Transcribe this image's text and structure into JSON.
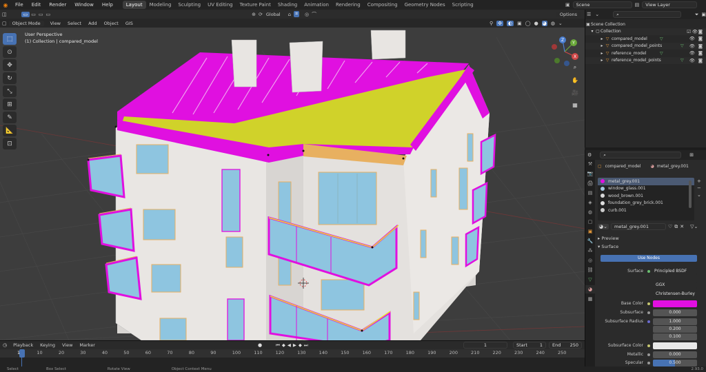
{
  "menu": {
    "items": [
      "File",
      "Edit",
      "Render",
      "Window",
      "Help"
    ]
  },
  "workspace_tabs": [
    "Layout",
    "Modeling",
    "Sculpting",
    "UV Editing",
    "Texture Paint",
    "Shading",
    "Animation",
    "Rendering",
    "Compositing",
    "Geometry Nodes",
    "Scripting"
  ],
  "active_tab": "Layout",
  "scene": {
    "name": "Scene",
    "view_layer": "View Layer"
  },
  "viewport": {
    "mode": "Object Mode",
    "header_menus": [
      "View",
      "Select",
      "Add",
      "Object",
      "GIS"
    ],
    "orientation": "Global",
    "options_label": "Options",
    "overlay_line1": "User Perspective",
    "overlay_line2": "(1) Collection | compared_model",
    "gizmo_axes": {
      "x": "X",
      "y": "Y",
      "z": "Z"
    }
  },
  "outliner": {
    "scene_collection": "Scene Collection",
    "collection": "Collection",
    "objects": [
      "compared_model",
      "compared_model_points",
      "reference_model",
      "reference_model_points"
    ]
  },
  "properties": {
    "object_name": "compared_model",
    "material_name": "metal_grey.001",
    "slots": [
      {
        "name": "metal_grey.001",
        "color": "#aaaaaa"
      },
      {
        "name": "window_glass.001",
        "color": "#a8c8e0"
      },
      {
        "name": "wood_brown.001",
        "color": "#d8d8d8"
      },
      {
        "name": "foundation_grey_brick.001",
        "color": "#dddddd"
      },
      {
        "name": "curb.001",
        "color": "#cccccc"
      }
    ],
    "preview_label": "Preview",
    "surface_label": "Surface",
    "use_nodes": "Use Nodes",
    "surface_field_label": "Surface",
    "surface_value": "Principled BSDF",
    "distribution": "GGX",
    "subsurface_method": "Christensen-Burley",
    "base_color_label": "Base Color",
    "base_color": "#e10fe1",
    "subsurface_label": "Subsurface",
    "subsurface_value": "0.000",
    "subsurface_radius_label": "Subsurface Radius",
    "subsurface_radius": [
      "1.000",
      "0.200",
      "0.100"
    ],
    "subsurface_color_label": "Subsurface Color",
    "subsurface_color": "#e8e8e8",
    "metallic_label": "Metallic",
    "metallic_value": "0.000",
    "specular_label": "Specular",
    "specular_value": "0.500",
    "specular_level": 0.5
  },
  "timeline": {
    "menus": [
      "Playback",
      "Keying",
      "View",
      "Marker"
    ],
    "current_frame": "1",
    "start_label": "Start",
    "start": "1",
    "end_label": "End",
    "end": "250",
    "ticks": [
      "1",
      "10",
      "20",
      "30",
      "40",
      "50",
      "60",
      "70",
      "80",
      "90",
      "100",
      "110",
      "120",
      "130",
      "140",
      "150",
      "160",
      "170",
      "180",
      "190",
      "200",
      "210",
      "220",
      "230",
      "240",
      "250"
    ]
  },
  "statusbar": {
    "items": [
      "Select",
      "Box Select",
      "Rotate View",
      "Object Context Menu"
    ],
    "version": "2.93.0"
  },
  "colors": {
    "accent": "#4772b3",
    "magenta": "#e10fe1",
    "yellow": "#d6d62e",
    "glass": "#8ec5e0",
    "wall": "#e7e4e1"
  }
}
